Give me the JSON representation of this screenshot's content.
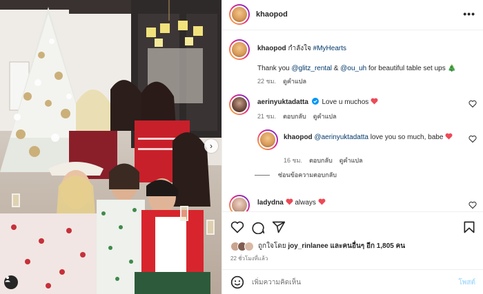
{
  "header": {
    "username": "khaopod",
    "more_label": "•••"
  },
  "caption": {
    "username": "khaopod",
    "first_line": " กำลังใจ ",
    "hashtag": "#MyHearts",
    "body_prefix": "Thank you ",
    "mention1": "@glitz_rental",
    "body_mid": " & ",
    "mention2": "@ou_uh",
    "body_suffix": " for beautiful table set ups 🎄",
    "time": "22 ชม.",
    "translate": "ดูคำแปล"
  },
  "comments": [
    {
      "username": "aerinyuktadatta",
      "text": "Love u muchos",
      "time": "21 ชม.",
      "reply": "ตอบกลับ",
      "translate": "ดูคำแปล"
    },
    {
      "username": "khaopod",
      "mention": "@aerinyuktadatta",
      "text": " love you so much, babe",
      "time": "16 ชม.",
      "reply": "ตอบกลับ",
      "translate": "ดูคำแปล"
    },
    {
      "username": "ladydna",
      "text": " always "
    }
  ],
  "hide_replies": "ซ่อนข้อความตอบกลับ",
  "likes": {
    "prefix": "ถูกใจโดย ",
    "user": "joy_rinlanee",
    "suffix": " และคนอื่นๆ อีก 1,805 คน"
  },
  "time_ago": "22 ชั่วโมงที่แล้ว",
  "composer": {
    "placeholder": "เพิ่มความคิดเห็น",
    "post_label": "โพสต์"
  },
  "colors": {
    "heart": "#ed4956",
    "link": "#00376b",
    "muted": "#737373",
    "verified": "#0095f6"
  }
}
